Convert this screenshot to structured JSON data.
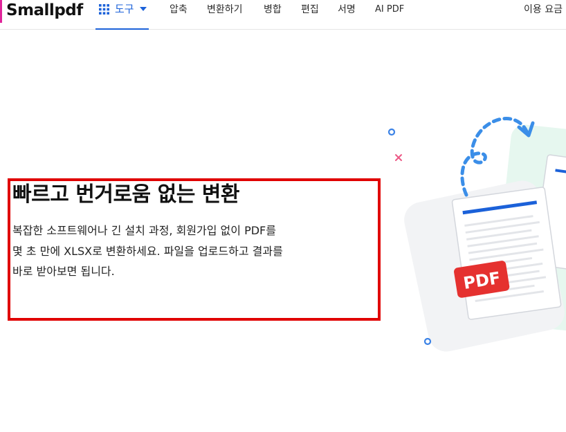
{
  "nav": {
    "brand": "Smallpdf",
    "tools_label": "도구",
    "links": [
      "압축",
      "변환하기",
      "병합",
      "편집",
      "서명",
      "AI PDF"
    ],
    "pricing": "이용 요금"
  },
  "hero": {
    "title": "빠르고 번거로움 없는 변환",
    "description_lines": [
      "복잡한 소프트웨어나 긴 설치 과정, 회원가입 없이 PDF를",
      "몇 초 만에 XLSX로 변환하세요. 파일을 업로드하고 결과를",
      "바로 받아보면 됩니다."
    ]
  },
  "illustration": {
    "badge_text": "PDF",
    "icons": [
      "grid-icon",
      "caret-down-icon",
      "refresh-arrow-icon",
      "document-icon"
    ]
  },
  "colors": {
    "accent": "#1b61d9",
    "brand_pink": "#e0249a",
    "pdf_red": "#e5312f",
    "highlight": "#e00000",
    "mint": "#e6f7ef"
  }
}
